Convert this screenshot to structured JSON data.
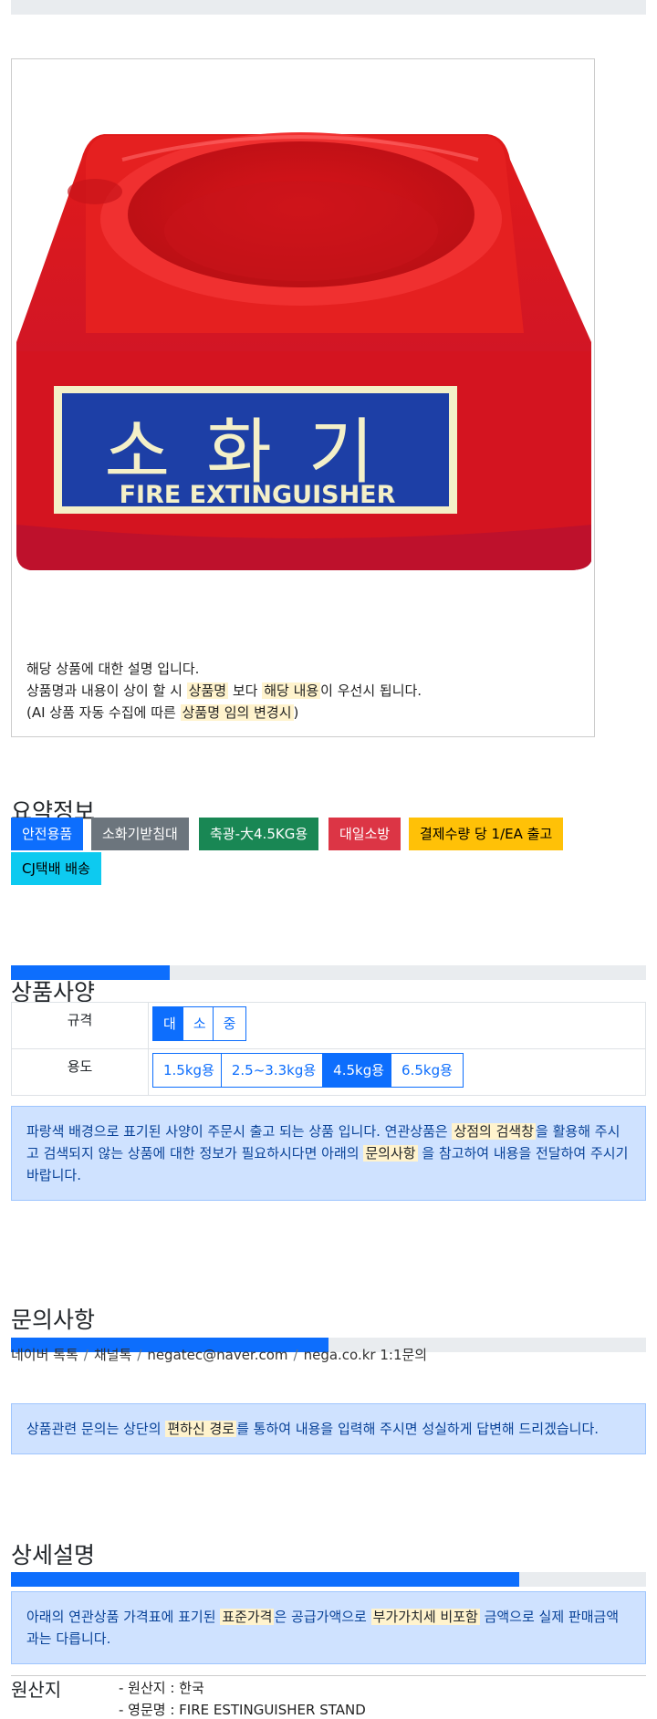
{
  "product": {
    "image_sign_korean": "소화기",
    "image_sign_english": "FIRE EXTINGUISHER",
    "description": [
      {
        "parts": [
          {
            "t": "해당 상품에 대한 설명 입니다.",
            "hl": false
          }
        ]
      },
      {
        "parts": [
          {
            "t": "상품명과 내용이 상이 할 시 ",
            "hl": false
          },
          {
            "t": "상품명",
            "hl": true
          },
          {
            "t": " 보다 ",
            "hl": false
          },
          {
            "t": "해당 내용",
            "hl": true
          },
          {
            "t": "이 우선시 됩니다.",
            "hl": false
          }
        ]
      },
      {
        "parts": [
          {
            "t": "(AI 상품 자동 수집에 따른 ",
            "hl": false
          },
          {
            "t": "상품명 임의 변경시",
            "hl": true
          },
          {
            "t": ")",
            "hl": false
          }
        ]
      }
    ]
  },
  "summary": {
    "title": "요약정보",
    "tags": [
      {
        "label": "안전용품",
        "color": "#0d6efd",
        "text": "#ffffff"
      },
      {
        "label": "소화기받침대",
        "color": "#6c757d",
        "text": "#ffffff"
      },
      {
        "label": "축광-大4.5KG용",
        "color": "#198754",
        "text": "#ffffff"
      },
      {
        "label": "대일소방",
        "color": "#dc3545",
        "text": "#ffffff"
      },
      {
        "label": "결제수량 당 1/EA 출고",
        "color": "#ffc107",
        "text": "#000000"
      },
      {
        "label": "CJ택배 배송",
        "color": "#0dcaf0",
        "text": "#000000"
      }
    ]
  },
  "spec": {
    "title": "상품사양",
    "progress_fraction": 0.25,
    "rows": [
      {
        "label": "규격",
        "options": [
          "대",
          "소",
          "중"
        ],
        "selected": "대"
      },
      {
        "label": "용도",
        "options": [
          "1.5kg용",
          "2.5~3.3kg용",
          "4.5kg용",
          "6.5kg용"
        ],
        "selected": "4.5kg용"
      }
    ],
    "notice": [
      {
        "t": "파랑색 배경으로 표기된 사양이 주문시 출고 되는 상품 입니다. 연관상품은 ",
        "hl": false
      },
      {
        "t": "상점의 검색창",
        "hl": true
      },
      {
        "t": "을 활용해 주시고 검색되지 않는 상품에 대한 정보가 필요하시다면 아래의 ",
        "hl": false
      },
      {
        "t": "문의사항",
        "hl": true
      },
      {
        "t": " 을 참고하여 내용을 전달하여 주시기 바랍니다.",
        "hl": false
      }
    ]
  },
  "inquiry": {
    "title": "문의사항",
    "progress_fraction": 0.5,
    "contacts": [
      "네이버 톡톡",
      "채널톡",
      "negatec@naver.com",
      "nega.co.kr 1:1문의"
    ],
    "notice": [
      {
        "t": "상품관련 문의는 상단의 ",
        "hl": false
      },
      {
        "t": "편하신 경로",
        "hl": true
      },
      {
        "t": "를 통하여 내용을 입력해 주시면 성실하게 답변해 드리겠습니다.",
        "hl": false
      }
    ]
  },
  "detail": {
    "title": "상세설명",
    "progress_fraction": 0.8,
    "notice": [
      {
        "t": "아래의 연관상품 가격표에 표기된 ",
        "hl": false
      },
      {
        "t": "표준가격",
        "hl": true
      },
      {
        "t": "은 공급가액으로 ",
        "hl": false
      },
      {
        "t": "부가가치세 비포함",
        "hl": true
      },
      {
        "t": " 금액으로 실제 판매금액과는 다릅니다.",
        "hl": false
      }
    ]
  },
  "origin": {
    "title": "원산지",
    "line1": "- 원산지 : 한국",
    "line2": "- 영문명 : FIRE ESTINGUISHER STAND"
  }
}
